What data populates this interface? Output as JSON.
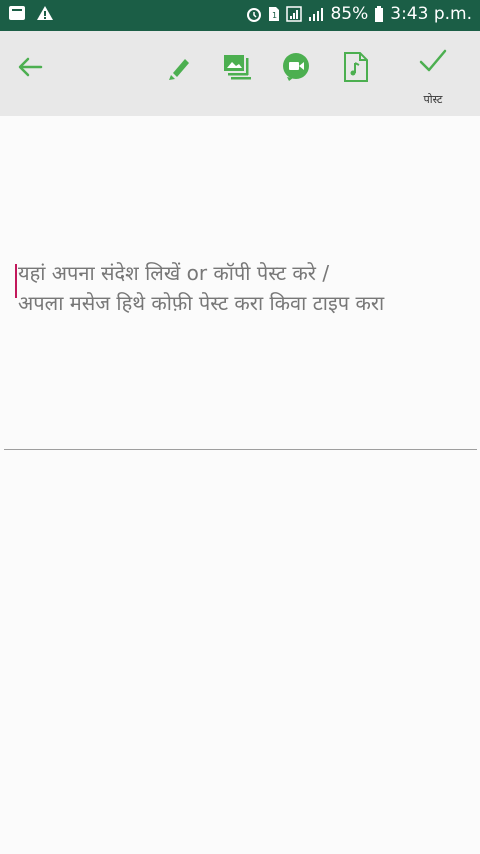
{
  "status_bar": {
    "battery": "85%",
    "time": "3:43 p.m.",
    "icons": [
      "message-icon",
      "warning-icon",
      "alarm-icon",
      "sim-icon",
      "signal-icon",
      "battery-icon"
    ]
  },
  "toolbar": {
    "post_label": "पोस्ट",
    "icons": [
      "back-arrow-icon",
      "highlighter-icon",
      "gallery-icon",
      "video-chat-icon",
      "audio-file-icon",
      "check-icon"
    ],
    "accent_color": "#4caf50"
  },
  "editor": {
    "placeholder_line1": "यहां अपना संदेश लिखें or कॉपी पेस्ट करे /",
    "placeholder_line2": "अपला मसेज हिथे कोफ़ी पेस्ट करा किवा टाइप करा"
  },
  "colors": {
    "status_bar": "#1b5e46",
    "toolbar_bg": "#e8e8e8",
    "icon_green": "#4caf50",
    "cursor": "#c2185b"
  }
}
